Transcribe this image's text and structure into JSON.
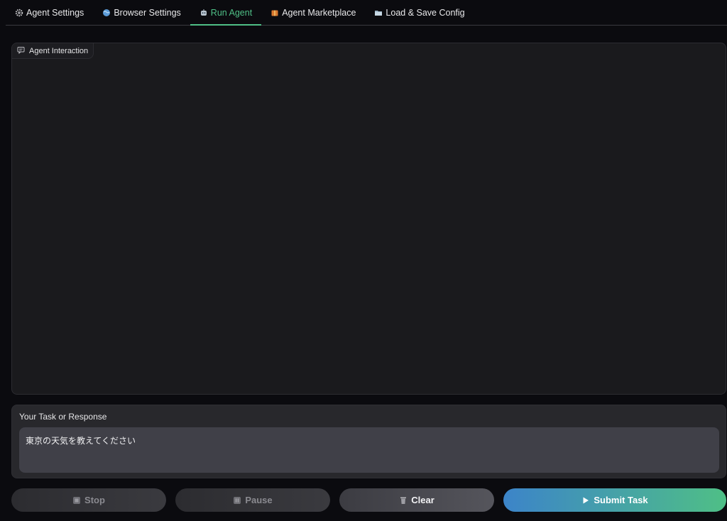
{
  "tabs": [
    {
      "label": "Agent Settings",
      "icon": "gear-icon",
      "active": false
    },
    {
      "label": "Browser Settings",
      "icon": "globe-icon",
      "active": false
    },
    {
      "label": "Run Agent",
      "icon": "robot-icon",
      "active": true
    },
    {
      "label": "Agent Marketplace",
      "icon": "package-icon",
      "active": false
    },
    {
      "label": "Load & Save Config",
      "icon": "folder-icon",
      "active": false
    }
  ],
  "chat": {
    "label": "Agent Interaction",
    "icon": "chat-icon"
  },
  "task": {
    "label": "Your Task or Response",
    "value": "東京の天気を教えてください"
  },
  "buttons": {
    "stop": "Stop",
    "pause": "Pause",
    "clear": "Clear",
    "submit": "Submit Task"
  },
  "colors": {
    "accent": "#4fbf86",
    "submit_gradient_start": "#3c84c9",
    "submit_gradient_end": "#4fbf86",
    "background": "#0b0b0f"
  }
}
